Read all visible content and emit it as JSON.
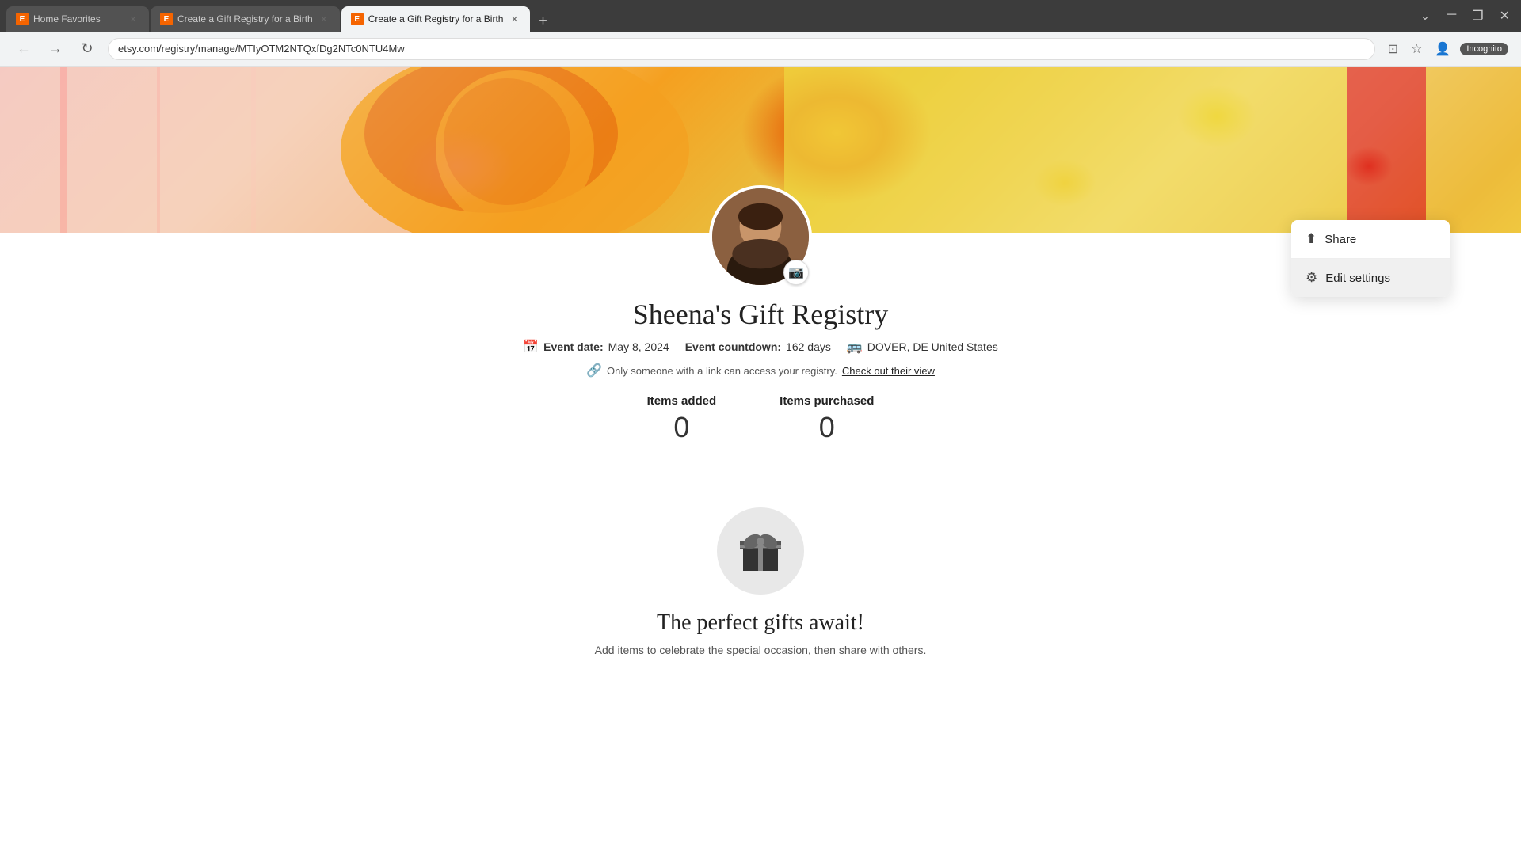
{
  "browser": {
    "tabs": [
      {
        "id": "tab1",
        "favicon": "E",
        "title": "Home Favorites",
        "active": false
      },
      {
        "id": "tab2",
        "favicon": "E",
        "title": "Create a Gift Registry for a Birth",
        "active": false
      },
      {
        "id": "tab3",
        "favicon": "E",
        "title": "Create a Gift Registry for a Birth",
        "active": true
      }
    ],
    "url": "etsy.com/registry/manage/MTIyOTM2NTQxfDg2NTc0NTU4Mw",
    "incognito_label": "Incognito"
  },
  "page": {
    "registry_title": "Sheena's Gift Registry",
    "event_label": "Event date:",
    "event_date": "May 8, 2024",
    "countdown_label": "Event countdown:",
    "countdown_days": "162 days",
    "location": "DOVER, DE United States",
    "privacy_note": "Only someone with a link can access your registry.",
    "privacy_link": "Check out their view",
    "items_added_label": "Items added",
    "items_added_value": "0",
    "items_purchased_label": "Items purchased",
    "items_purchased_value": "0",
    "empty_title": "The perfect gifts await!",
    "empty_subtitle": "Add items to celebrate the special occasion, then share with others."
  },
  "dropdown": {
    "share_label": "Share",
    "edit_settings_label": "Edit settings"
  }
}
